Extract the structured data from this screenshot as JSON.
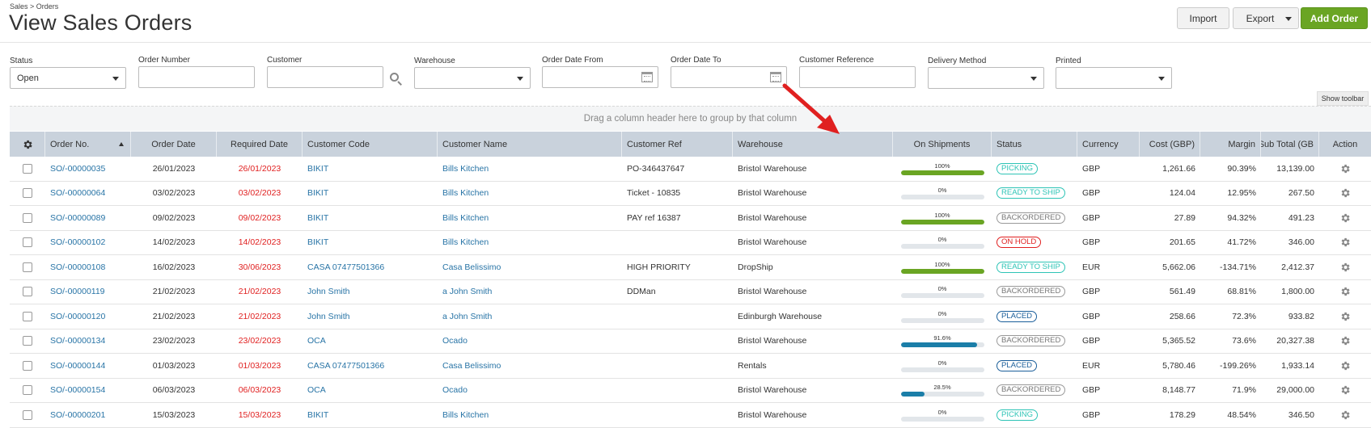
{
  "breadcrumb": "Sales > Orders",
  "page_title": "View Sales Orders",
  "toolbar": {
    "import_label": "Import",
    "export_label": "Export",
    "add_order_label": "Add Order"
  },
  "filters": {
    "status": {
      "label": "Status",
      "value": "Open"
    },
    "order_number": {
      "label": "Order Number",
      "value": ""
    },
    "customer": {
      "label": "Customer",
      "value": ""
    },
    "warehouse": {
      "label": "Warehouse",
      "value": ""
    },
    "order_date_from": {
      "label": "Order Date From",
      "value": ""
    },
    "order_date_to": {
      "label": "Order Date To",
      "value": ""
    },
    "customer_reference": {
      "label": "Customer Reference",
      "value": ""
    },
    "delivery_method": {
      "label": "Delivery Method",
      "value": ""
    },
    "printed": {
      "label": "Printed",
      "value": ""
    }
  },
  "show_toolbar_label": "Show toolbar",
  "group_bar_text": "Drag a column header here to group by that column",
  "columns": {
    "order_no": "Order No.",
    "order_date": "Order Date",
    "required_date": "Required Date",
    "customer_code": "Customer Code",
    "customer_name": "Customer Name",
    "customer_ref": "Customer Ref",
    "warehouse": "Warehouse",
    "on_shipments": "On Shipments",
    "status": "Status",
    "currency": "Currency",
    "cost": "Cost (GBP)",
    "margin": "Margin",
    "sub_total": "Sub Total (GB",
    "action": "Action"
  },
  "colors": {
    "accent_green": "#6aa523",
    "progress_green": "#6aa523",
    "progress_blue": "#1b7ea8",
    "link": "#2874a6",
    "overdue_red": "#e02020",
    "header_bg": "#c9d2dc",
    "annotation_arrow": "#e02020"
  },
  "icons": {
    "settings": "gear-icon",
    "search": "search-icon",
    "calendar": "calendar-icon",
    "dropdown": "chevron-down-icon",
    "sort": "sort-ascending-icon"
  },
  "rows": [
    {
      "order_no": "SO/-00000035",
      "order_date": "26/01/2023",
      "required_date": "26/01/2023",
      "customer_code": "BIKIT",
      "customer_name": "Bills Kitchen",
      "customer_ref": "PO-346437647",
      "warehouse": "Bristol Warehouse",
      "shipment_pct": "100%",
      "shipment_fraction": 1.0,
      "shipment_color": "green",
      "status": "PICKING",
      "status_class": "st-picking",
      "currency": "GBP",
      "cost": "1,261.66",
      "margin": "90.39%",
      "sub_total": "13,139.00"
    },
    {
      "order_no": "SO/-00000064",
      "order_date": "03/02/2023",
      "required_date": "03/02/2023",
      "customer_code": "BIKIT",
      "customer_name": "Bills Kitchen",
      "customer_ref": "Ticket - 10835",
      "warehouse": "Bristol Warehouse",
      "shipment_pct": "0%",
      "shipment_fraction": 0,
      "shipment_color": "green",
      "status": "READY TO SHIP",
      "status_class": "st-ready",
      "currency": "GBP",
      "cost": "124.04",
      "margin": "12.95%",
      "sub_total": "267.50"
    },
    {
      "order_no": "SO/-00000089",
      "order_date": "09/02/2023",
      "required_date": "09/02/2023",
      "customer_code": "BIKIT",
      "customer_name": "Bills Kitchen",
      "customer_ref": "PAY ref 16387",
      "warehouse": "Bristol Warehouse",
      "shipment_pct": "100%",
      "shipment_fraction": 1.0,
      "shipment_color": "green",
      "status": "BACKORDERED",
      "status_class": "st-back",
      "currency": "GBP",
      "cost": "27.89",
      "margin": "94.32%",
      "sub_total": "491.23"
    },
    {
      "order_no": "SO/-00000102",
      "order_date": "14/02/2023",
      "required_date": "14/02/2023",
      "customer_code": "BIKIT",
      "customer_name": "Bills Kitchen",
      "customer_ref": "",
      "warehouse": "Bristol Warehouse",
      "shipment_pct": "0%",
      "shipment_fraction": 0,
      "shipment_color": "green",
      "status": "ON HOLD",
      "status_class": "st-hold",
      "currency": "GBP",
      "cost": "201.65",
      "margin": "41.72%",
      "sub_total": "346.00"
    },
    {
      "order_no": "SO/-00000108",
      "order_date": "16/02/2023",
      "required_date": "30/06/2023",
      "customer_code": "CASA 07477501366",
      "customer_name": "Casa Belissimo",
      "customer_ref": "HIGH PRIORITY",
      "warehouse": "DropShip",
      "shipment_pct": "100%",
      "shipment_fraction": 1.0,
      "shipment_color": "green",
      "status": "READY TO SHIP",
      "status_class": "st-ready",
      "currency": "EUR",
      "cost": "5,662.06",
      "margin": "-134.71%",
      "sub_total": "2,412.37"
    },
    {
      "order_no": "SO/-00000119",
      "order_date": "21/02/2023",
      "required_date": "21/02/2023",
      "customer_code": "John Smith",
      "customer_name": "a John Smith",
      "customer_ref": "DDMan",
      "warehouse": "Bristol Warehouse",
      "shipment_pct": "0%",
      "shipment_fraction": 0,
      "shipment_color": "green",
      "status": "BACKORDERED",
      "status_class": "st-back",
      "currency": "GBP",
      "cost": "561.49",
      "margin": "68.81%",
      "sub_total": "1,800.00"
    },
    {
      "order_no": "SO/-00000120",
      "order_date": "21/02/2023",
      "required_date": "21/02/2023",
      "customer_code": "John Smith",
      "customer_name": "a John Smith",
      "customer_ref": "",
      "warehouse": "Edinburgh Warehouse",
      "shipment_pct": "0%",
      "shipment_fraction": 0,
      "shipment_color": "green",
      "status": "PLACED",
      "status_class": "st-placed",
      "currency": "GBP",
      "cost": "258.66",
      "margin": "72.3%",
      "sub_total": "933.82"
    },
    {
      "order_no": "SO/-00000134",
      "order_date": "23/02/2023",
      "required_date": "23/02/2023",
      "customer_code": "OCA",
      "customer_name": "Ocado",
      "customer_ref": "",
      "warehouse": "Bristol Warehouse",
      "shipment_pct": "91.6%",
      "shipment_fraction": 0.916,
      "shipment_color": "blue",
      "status": "BACKORDERED",
      "status_class": "st-back",
      "currency": "GBP",
      "cost": "5,365.52",
      "margin": "73.6%",
      "sub_total": "20,327.38"
    },
    {
      "order_no": "SO/-00000144",
      "order_date": "01/03/2023",
      "required_date": "01/03/2023",
      "customer_code": "CASA 07477501366",
      "customer_name": "Casa Belissimo",
      "customer_ref": "",
      "warehouse": "Rentals",
      "shipment_pct": "0%",
      "shipment_fraction": 0,
      "shipment_color": "green",
      "status": "PLACED",
      "status_class": "st-placed",
      "currency": "EUR",
      "cost": "5,780.46",
      "margin": "-199.26%",
      "sub_total": "1,933.14"
    },
    {
      "order_no": "SO/-00000154",
      "order_date": "06/03/2023",
      "required_date": "06/03/2023",
      "customer_code": "OCA",
      "customer_name": "Ocado",
      "customer_ref": "",
      "warehouse": "Bristol Warehouse",
      "shipment_pct": "28.5%",
      "shipment_fraction": 0.285,
      "shipment_color": "blue",
      "status": "BACKORDERED",
      "status_class": "st-back",
      "currency": "GBP",
      "cost": "8,148.77",
      "margin": "71.9%",
      "sub_total": "29,000.00"
    },
    {
      "order_no": "SO/-00000201",
      "order_date": "15/03/2023",
      "required_date": "15/03/2023",
      "customer_code": "BIKIT",
      "customer_name": "Bills Kitchen",
      "customer_ref": "",
      "warehouse": "Bristol Warehouse",
      "shipment_pct": "0%",
      "shipment_fraction": 0,
      "shipment_color": "green",
      "status": "PICKING",
      "status_class": "st-picking",
      "currency": "GBP",
      "cost": "178.29",
      "margin": "48.54%",
      "sub_total": "346.50"
    }
  ]
}
